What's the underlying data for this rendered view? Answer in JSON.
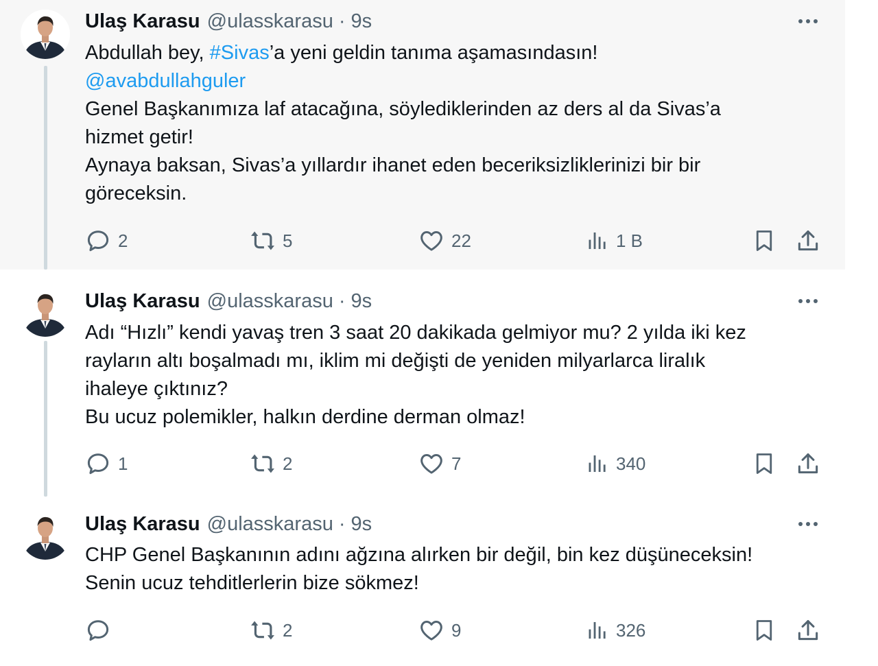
{
  "tweets": [
    {
      "author": "Ulaş Karasu",
      "handle": "@ulasskarasu",
      "separator": "·",
      "time": "9s",
      "text": {
        "l1a": "Abdullah bey, ",
        "hashtag": "#Sivas",
        "l1b": "’a yeni geldin tanıma aşamasındasın!",
        "mention": "@avabdullahguler",
        "l3": "Genel Başkanımıza laf atacağına, söylediklerinden az ders al da Sivas’a",
        "l4": "hizmet getir!",
        "l5": "Aynaya baksan, Sivas’a yıllardır ihanet eden beceriksizliklerinizi bir bir",
        "l6": "göreceksin."
      },
      "stats": {
        "replies": "2",
        "reposts": "5",
        "likes": "22",
        "views": "1 B"
      }
    },
    {
      "author": "Ulaş Karasu",
      "handle": "@ulasskarasu",
      "separator": "·",
      "time": "9s",
      "text": {
        "l1": "Adı “Hızlı” kendi yavaş tren 3 saat 20 dakikada gelmiyor mu? 2 yılda iki kez",
        "l2": "rayların altı boşalmadı mı, iklim mi değişti de yeniden milyarlarca liralık",
        "l3": "ihaleye çıktınız?",
        "l4": "Bu ucuz polemikler, halkın derdine derman olmaz!"
      },
      "stats": {
        "replies": "1",
        "reposts": "2",
        "likes": "7",
        "views": "340"
      }
    },
    {
      "author": "Ulaş Karasu",
      "handle": "@ulasskarasu",
      "separator": "·",
      "time": "9s",
      "text": {
        "l1": "CHP Genel Başkanının adını ağzına alırken bir değil, bin kez düşüneceksin!",
        "l2": "Senin ucuz tehditlerlerin bize sökmez!"
      },
      "stats": {
        "replies": "",
        "reposts": "2",
        "likes": "9",
        "views": "326"
      }
    }
  ],
  "colors": {
    "text": "#0f1419",
    "muted": "#536471",
    "link": "#1d9bf0",
    "highlight_bg": "#f7f7f7",
    "thread_line": "#cfd9de"
  },
  "icons": [
    "reply-icon",
    "repost-icon",
    "like-icon",
    "views-icon",
    "bookmark-icon",
    "share-icon",
    "more-icon"
  ]
}
